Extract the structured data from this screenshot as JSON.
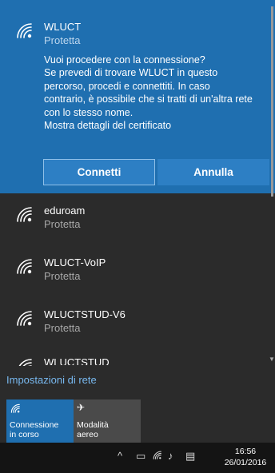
{
  "selected_network": {
    "name": "WLUCT",
    "status": "Protetta",
    "prompt_lines": [
      "Vuoi procedere con la connessione?",
      "Se prevedi di trovare WLUCT in questo",
      "percorso, procedi e connettiti. In caso",
      "contrario, è possibile che si tratti di un'altra rete",
      "con lo stesso nome.",
      "Mostra dettagli del certificato"
    ],
    "connect_label": "Connetti",
    "cancel_label": "Annulla"
  },
  "networks": [
    {
      "name": "eduroam",
      "status": "Protetta"
    },
    {
      "name": "WLUCT-VoIP",
      "status": "Protetta"
    },
    {
      "name": "WLUCTSTUD-V6",
      "status": "Protetta"
    },
    {
      "name": "WLUCTSTUD",
      "status": ""
    }
  ],
  "settings_link": "Impostazioni di rete",
  "quick_actions": [
    {
      "icon": "wifi-icon",
      "line1": "Connessione",
      "line2": "in corso"
    },
    {
      "icon": "airplane-icon",
      "line1": "Modalità",
      "line2": "aereo"
    }
  ],
  "taskbar": {
    "time": "16:56",
    "date": "26/01/2016"
  },
  "colors": {
    "accent": "#1f6fb0",
    "flyout_bg": "#2b2b2b",
    "link": "#78b8ef"
  }
}
